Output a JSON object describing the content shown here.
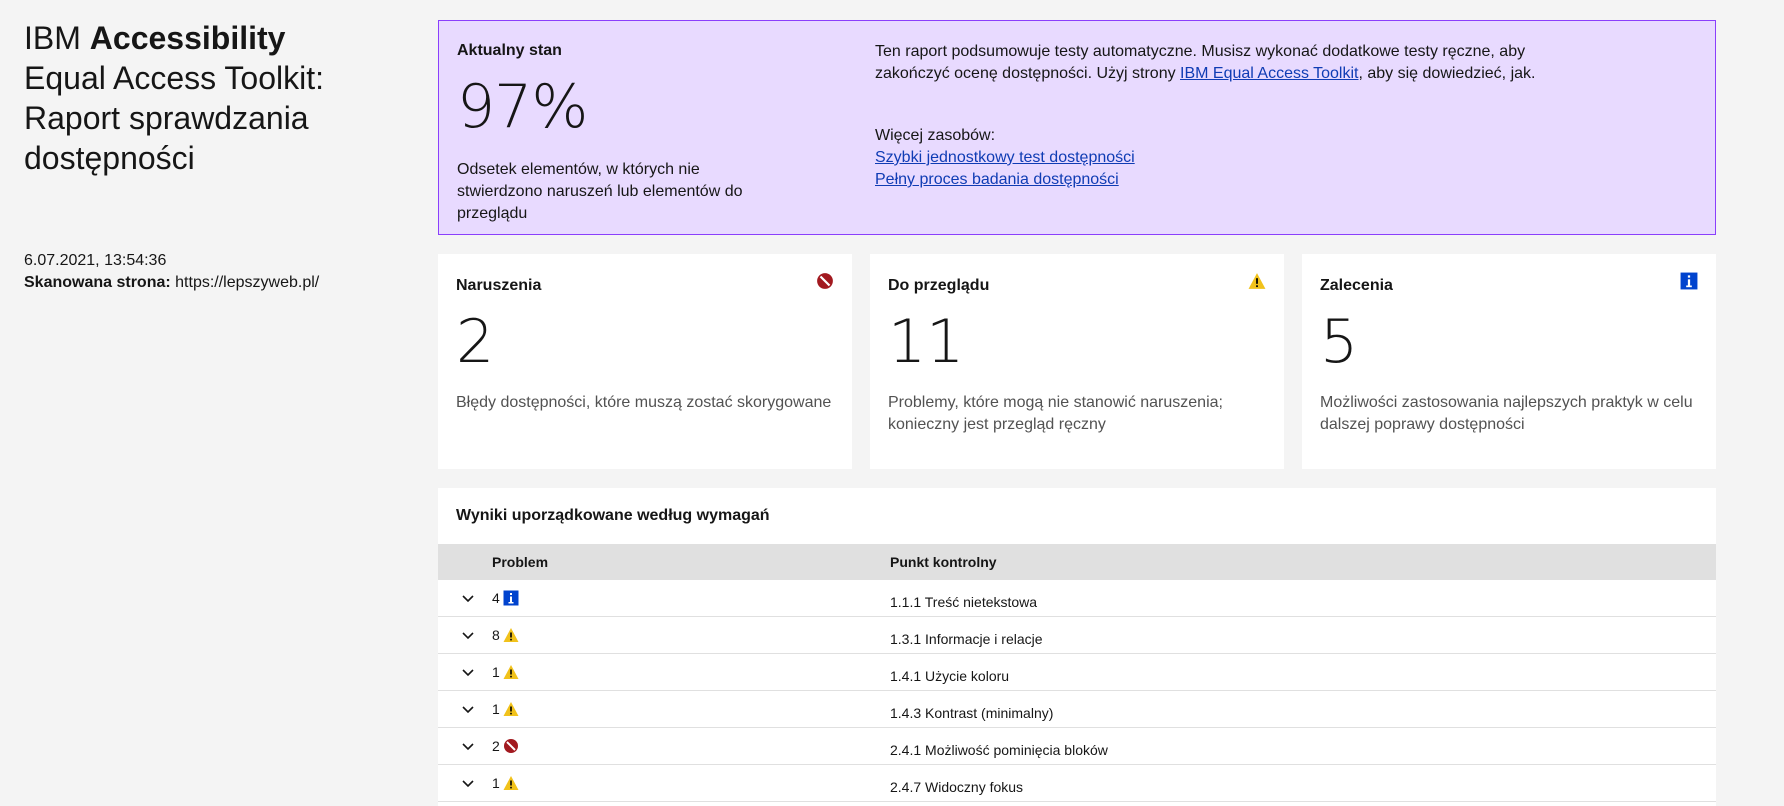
{
  "app": {
    "title_prefix": "IBM ",
    "title_bold": "Accessibility",
    "title_rest": "Equal Access Toolkit: Raport sprawdzania dostępności"
  },
  "scan": {
    "datetime": "6.07.2021, 13:54:36",
    "page_label": "Skanowana strona:",
    "page_url": "https://lepszyweb.pl/"
  },
  "current_state": {
    "label": "Aktualny stan",
    "percent": "97%",
    "description": "Odsetek elementów, w których nie stwierdzono naruszeń lub elementów do przeglądu",
    "info_before": "Ten raport podsumowuje testy automatyczne. Musisz wykonać dodatkowe testy ręczne, aby zakończyć ocenę dostępności. Użyj strony ",
    "info_link": "IBM Equal Access Toolkit",
    "info_after": ", aby się dowiedzieć, jak.",
    "resources_label": "Więcej zasobów:",
    "resource_1": "Szybki jednostkowy test dostępności",
    "resource_2": "Pełny proces badania dostępności"
  },
  "cards": {
    "violations": {
      "label": "Naruszenia",
      "count": "2",
      "description": "Błędy dostępności, które muszą zostać skorygowane",
      "icon": "violation-icon"
    },
    "review": {
      "label": "Do przeglądu",
      "count": "11",
      "description": "Problemy, które mogą nie stanowić naruszenia; konieczny jest przegląd ręczny",
      "icon": "warning-icon"
    },
    "recommendations": {
      "label": "Zalecenia",
      "count": "5",
      "description": "Możliwości zastosowania najlepszych praktyk w celu dalszej poprawy dostępności",
      "icon": "info-icon"
    }
  },
  "results": {
    "title": "Wyniki uporządkowane według wymagań",
    "col_problem": "Problem",
    "col_checkpoint": "Punkt kontrolny",
    "rows": [
      {
        "count": "4",
        "type": "info",
        "checkpoint": "1.1.1 Treść nietekstowa"
      },
      {
        "count": "8",
        "type": "warning",
        "checkpoint": "1.3.1 Informacje i relacje"
      },
      {
        "count": "1",
        "type": "warning",
        "checkpoint": "1.4.1 Użycie koloru"
      },
      {
        "count": "1",
        "type": "warning",
        "checkpoint": "1.4.3 Kontrast (minimalny)"
      },
      {
        "count": "2",
        "type": "violation",
        "checkpoint": "2.4.1 Możliwość pominięcia bloków"
      },
      {
        "count": "1",
        "type": "warning",
        "checkpoint": "2.4.7 Widoczny fokus"
      }
    ]
  },
  "colors": {
    "state_bg": "#e8daff",
    "state_border": "#8a3ffc",
    "link": "#0f3cb4",
    "violation": "#a2191f",
    "warning": "#f1c21b",
    "info": "#0043ce"
  }
}
